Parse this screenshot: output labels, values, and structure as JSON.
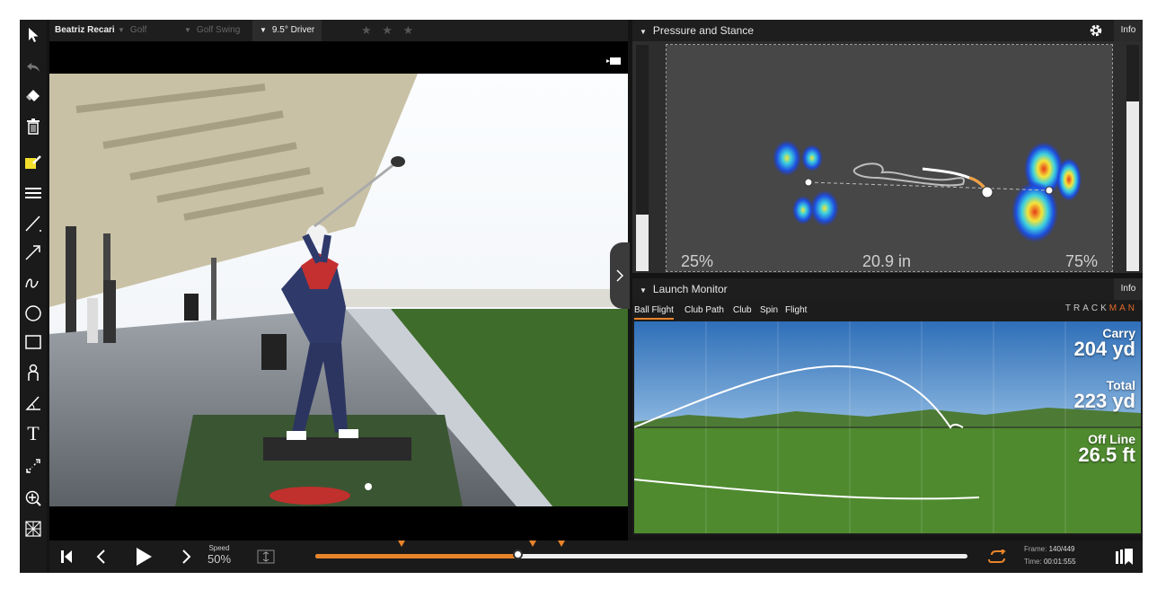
{
  "toolbar": {
    "tools": [
      "pointer-icon",
      "undo-icon",
      "eraser-icon",
      "trash-icon",
      "color-picker-icon",
      "line-width-icon",
      "line-icon",
      "arrow-icon",
      "freehand-icon",
      "circle-icon",
      "rectangle-icon",
      "person-icon",
      "angle-icon",
      "text-icon",
      "distance-icon",
      "zoom-icon",
      "grid-icon"
    ],
    "text_tool_glyph": "T"
  },
  "video_bar": {
    "player": "Beatriz Recari",
    "category": "Golf",
    "drill": "Golf Swing",
    "club": "9.5° Driver",
    "rating": "★ ★ ★"
  },
  "pressure": {
    "title": "Pressure and Stance",
    "info_label": "Info",
    "left_pct": "25%",
    "width": "20.9 in",
    "right_pct": "75%",
    "left_bar_level": 0.25,
    "right_bar_level": 0.75
  },
  "launch": {
    "title": "Launch Monitor",
    "info_label": "Info",
    "brand_a": "TRACK",
    "brand_b": "MAN",
    "tabs": [
      "Ball Flight",
      "Club Path",
      "Club",
      "Spin",
      "Flight"
    ],
    "active_tab": 0,
    "carry_label": "Carry",
    "carry_value": "204 yd",
    "total_label": "Total",
    "total_value": "223 yd",
    "offline_label": "Off Line",
    "offline_value": "26.5 ft"
  },
  "controls": {
    "speed_label": "Speed",
    "speed_value": "50%",
    "progress": 0.31,
    "frame_label": "Frame:",
    "frame_value": "140/449",
    "time_label": "Time:",
    "time_value": "00:01:555"
  },
  "colors": {
    "accent": "#e8842a",
    "sky": "#3f7ec6",
    "grass": "#4f8a2f"
  }
}
